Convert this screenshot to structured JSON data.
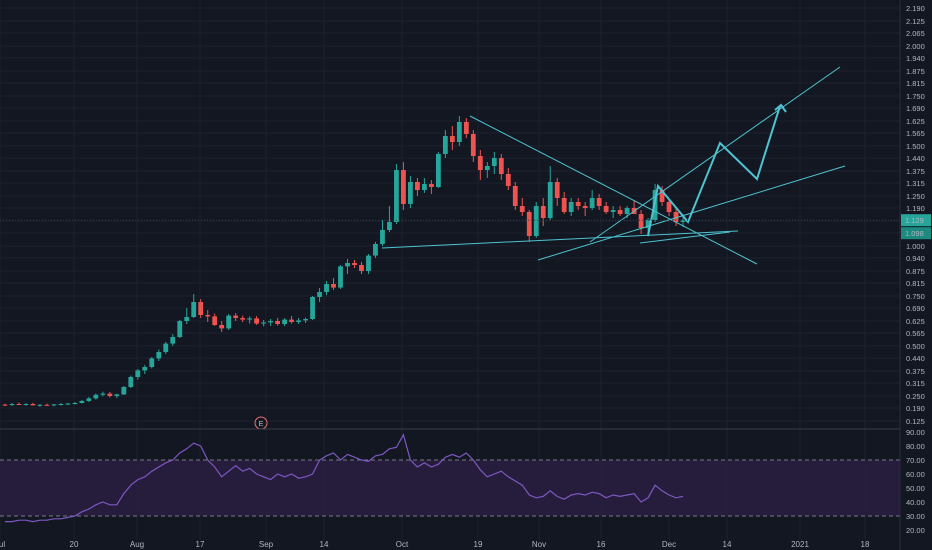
{
  "chart_data": {
    "type": "candlestick",
    "title": "",
    "colors": {
      "up": "#26a69a",
      "down": "#ef5350",
      "background": "#131722",
      "rsi_line": "#7e57c2",
      "rsi_band": "#2a1d3f",
      "drawing": "#4dc4d0",
      "grid": "#1e222d"
    },
    "price_axis": {
      "ticks": [
        "2.190",
        "2.125",
        "2.065",
        "2.000",
        "1.940",
        "1.875",
        "1.815",
        "1.750",
        "1.690",
        "1.625",
        "1.565",
        "1.500",
        "1.440",
        "1.375",
        "1.315",
        "1.250",
        "1.190",
        "1.125",
        "1.065",
        "1.000",
        "0.940",
        "0.875",
        "0.815",
        "0.750",
        "0.690",
        "0.625",
        "0.565",
        "0.500",
        "0.440",
        "0.375",
        "0.315",
        "0.250",
        "0.190",
        "0.125"
      ],
      "ylim": [
        0.125,
        2.19
      ],
      "current_price_label": "1.129",
      "current_price_label_2": "1.098"
    },
    "time_axis": {
      "labels": [
        "Jul",
        "20",
        "Aug",
        "17",
        "Sep",
        "14",
        "Oct",
        "19",
        "Nov",
        "16",
        "Dec",
        "14",
        "2021",
        "18"
      ]
    },
    "rsi_axis": {
      "ticks": [
        "90.00",
        "80.00",
        "70.00",
        "60.00",
        "50.00",
        "40.00",
        "30.00",
        "20.00"
      ],
      "ylim": [
        20,
        90
      ],
      "upper_band": 70,
      "lower_band": 30
    },
    "earnings_marker": "E",
    "candles": [
      [
        0.207,
        0.212,
        0.2,
        0.205
      ],
      [
        0.205,
        0.215,
        0.2,
        0.21
      ],
      [
        0.21,
        0.218,
        0.205,
        0.208
      ],
      [
        0.208,
        0.214,
        0.202,
        0.21
      ],
      [
        0.21,
        0.216,
        0.204,
        0.203
      ],
      [
        0.203,
        0.21,
        0.196,
        0.206
      ],
      [
        0.206,
        0.212,
        0.2,
        0.204
      ],
      [
        0.204,
        0.21,
        0.198,
        0.208
      ],
      [
        0.208,
        0.215,
        0.203,
        0.21
      ],
      [
        0.21,
        0.216,
        0.205,
        0.212
      ],
      [
        0.212,
        0.22,
        0.208,
        0.215
      ],
      [
        0.215,
        0.23,
        0.212,
        0.225
      ],
      [
        0.225,
        0.245,
        0.22,
        0.238
      ],
      [
        0.238,
        0.262,
        0.232,
        0.256
      ],
      [
        0.256,
        0.272,
        0.248,
        0.262
      ],
      [
        0.262,
        0.27,
        0.242,
        0.25
      ],
      [
        0.25,
        0.262,
        0.24,
        0.258
      ],
      [
        0.258,
        0.3,
        0.255,
        0.295
      ],
      [
        0.295,
        0.352,
        0.29,
        0.345
      ],
      [
        0.345,
        0.385,
        0.332,
        0.378
      ],
      [
        0.378,
        0.405,
        0.36,
        0.395
      ],
      [
        0.395,
        0.445,
        0.388,
        0.438
      ],
      [
        0.438,
        0.482,
        0.425,
        0.47
      ],
      [
        0.47,
        0.52,
        0.46,
        0.512
      ],
      [
        0.512,
        0.56,
        0.5,
        0.545
      ],
      [
        0.545,
        0.63,
        0.54,
        0.625
      ],
      [
        0.625,
        0.69,
        0.61,
        0.645
      ],
      [
        0.645,
        0.76,
        0.64,
        0.72
      ],
      [
        0.72,
        0.735,
        0.64,
        0.655
      ],
      [
        0.655,
        0.68,
        0.62,
        0.648
      ],
      [
        0.648,
        0.662,
        0.6,
        0.605
      ],
      [
        0.605,
        0.625,
        0.57,
        0.588
      ],
      [
        0.588,
        0.66,
        0.58,
        0.652
      ],
      [
        0.652,
        0.665,
        0.625,
        0.64
      ],
      [
        0.64,
        0.652,
        0.62,
        0.632
      ],
      [
        0.632,
        0.648,
        0.612,
        0.638
      ],
      [
        0.638,
        0.65,
        0.605,
        0.612
      ],
      [
        0.612,
        0.63,
        0.598,
        0.618
      ],
      [
        0.618,
        0.635,
        0.6,
        0.625
      ],
      [
        0.625,
        0.64,
        0.602,
        0.61
      ],
      [
        0.61,
        0.64,
        0.6,
        0.632
      ],
      [
        0.632,
        0.65,
        0.612,
        0.62
      ],
      [
        0.62,
        0.64,
        0.61,
        0.628
      ],
      [
        0.628,
        0.642,
        0.615,
        0.635
      ],
      [
        0.635,
        0.75,
        0.63,
        0.745
      ],
      [
        0.745,
        0.79,
        0.72,
        0.77
      ],
      [
        0.77,
        0.825,
        0.755,
        0.81
      ],
      [
        0.81,
        0.84,
        0.78,
        0.792
      ],
      [
        0.792,
        0.905,
        0.785,
        0.898
      ],
      [
        0.898,
        0.935,
        0.86,
        0.915
      ],
      [
        0.915,
        0.93,
        0.89,
        0.905
      ],
      [
        0.905,
        0.92,
        0.86,
        0.875
      ],
      [
        0.875,
        0.96,
        0.86,
        0.952
      ],
      [
        0.952,
        1.02,
        0.94,
        1.01
      ],
      [
        1.01,
        1.13,
        1.0,
        1.08
      ],
      [
        1.08,
        1.2,
        1.07,
        1.12
      ],
      [
        1.12,
        1.41,
        1.11,
        1.38
      ],
      [
        1.38,
        1.42,
        1.18,
        1.21
      ],
      [
        1.21,
        1.35,
        1.19,
        1.32
      ],
      [
        1.32,
        1.34,
        1.25,
        1.28
      ],
      [
        1.28,
        1.34,
        1.265,
        1.31
      ],
      [
        1.31,
        1.33,
        1.26,
        1.295
      ],
      [
        1.295,
        1.47,
        1.29,
        1.46
      ],
      [
        1.46,
        1.58,
        1.44,
        1.55
      ],
      [
        1.55,
        1.6,
        1.48,
        1.52
      ],
      [
        1.52,
        1.65,
        1.5,
        1.62
      ],
      [
        1.62,
        1.64,
        1.54,
        1.56
      ],
      [
        1.56,
        1.58,
        1.42,
        1.45
      ],
      [
        1.45,
        1.48,
        1.33,
        1.38
      ],
      [
        1.38,
        1.42,
        1.34,
        1.4
      ],
      [
        1.4,
        1.47,
        1.36,
        1.44
      ],
      [
        1.44,
        1.46,
        1.33,
        1.36
      ],
      [
        1.36,
        1.39,
        1.28,
        1.3
      ],
      [
        1.3,
        1.32,
        1.18,
        1.2
      ],
      [
        1.2,
        1.24,
        1.15,
        1.17
      ],
      [
        1.17,
        1.18,
        1.02,
        1.05
      ],
      [
        1.05,
        1.22,
        1.04,
        1.2
      ],
      [
        1.2,
        1.24,
        1.1,
        1.14
      ],
      [
        1.14,
        1.4,
        1.13,
        1.32
      ],
      [
        1.32,
        1.34,
        1.2,
        1.24
      ],
      [
        1.24,
        1.27,
        1.16,
        1.17
      ],
      [
        1.17,
        1.24,
        1.15,
        1.22
      ],
      [
        1.22,
        1.24,
        1.18,
        1.2
      ],
      [
        1.2,
        1.22,
        1.15,
        1.19
      ],
      [
        1.19,
        1.28,
        1.18,
        1.24
      ],
      [
        1.24,
        1.26,
        1.18,
        1.2
      ],
      [
        1.2,
        1.22,
        1.16,
        1.17
      ],
      [
        1.17,
        1.2,
        1.14,
        1.18
      ],
      [
        1.18,
        1.2,
        1.15,
        1.16
      ],
      [
        1.16,
        1.2,
        1.14,
        1.19
      ],
      [
        1.19,
        1.23,
        1.16,
        1.16
      ],
      [
        1.16,
        1.18,
        1.06,
        1.09
      ],
      [
        1.09,
        1.14,
        1.06,
        1.13
      ],
      [
        1.13,
        1.31,
        1.12,
        1.28
      ],
      [
        1.28,
        1.3,
        1.2,
        1.22
      ],
      [
        1.22,
        1.23,
        1.15,
        1.17
      ],
      [
        1.17,
        1.19,
        1.1,
        1.12
      ],
      [
        1.12,
        1.16,
        1.095,
        1.129
      ]
    ],
    "rsi": [
      26,
      26,
      27,
      27,
      26,
      27,
      27,
      28,
      28,
      29,
      30,
      33,
      35,
      38,
      40,
      38,
      38,
      46,
      52,
      56,
      58,
      62,
      65,
      68,
      70,
      75,
      78,
      82,
      80,
      70,
      65,
      58,
      62,
      66,
      62,
      64,
      60,
      58,
      56,
      60,
      58,
      60,
      57,
      58,
      60,
      70,
      73,
      75,
      70,
      74,
      72,
      70,
      69,
      73,
      74,
      78,
      79,
      88,
      70,
      65,
      68,
      65,
      67,
      72,
      74,
      72,
      75,
      70,
      63,
      58,
      60,
      62,
      58,
      55,
      52,
      45,
      43,
      44,
      48,
      44,
      42,
      45,
      46,
      45,
      47,
      46,
      43,
      45,
      44,
      45,
      46,
      40,
      43,
      52,
      48,
      45,
      43,
      44
    ]
  }
}
